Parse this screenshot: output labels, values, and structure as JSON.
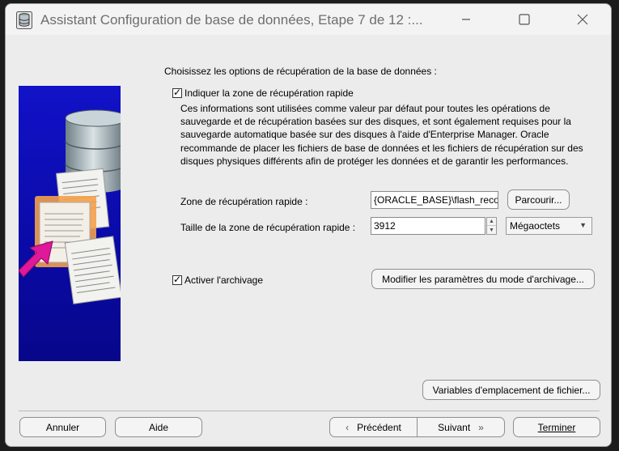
{
  "window": {
    "title": "Assistant Configuration de base de données, Etape 7 de 12 :..."
  },
  "titlebar_buttons": {
    "minimize_icon": "minimize-icon",
    "maximize_icon": "maximize-icon",
    "close_icon": "close-icon"
  },
  "main": {
    "prompt": "Choisissez les options de récupération de la base de données :",
    "fast_recovery": {
      "checked": true,
      "label": "Indiquer la zone de récupération rapide",
      "description": "Ces informations sont utilisées comme valeur par défaut pour toutes les opérations de sauvegarde et de récupération basées sur des disques, et sont également requises pour la sauvegarde automatique basée sur des disques à l'aide d'Enterprise Manager. Oracle recommande de placer les fichiers de base de données et les fichiers de récupération sur des disques physiques différents afin de protéger les données et de garantir les performances.",
      "zone_label": "Zone de récupération rapide :",
      "zone_value": "{ORACLE_BASE}\\flash_reco",
      "browse_label": "Parcourir...",
      "size_label": "Taille de la zone de récupération rapide :",
      "size_value": "3912",
      "unit_value": "Mégaoctets"
    },
    "archiving": {
      "checked": true,
      "label": "Activer l'archivage",
      "modify_label": "Modifier les paramètres du mode d'archivage..."
    },
    "file_vars_label": "Variables d'emplacement de fichier..."
  },
  "footer": {
    "cancel_label": "Annuler",
    "help_label": "Aide",
    "previous_label": "Précédent",
    "next_label": "Suivant",
    "finish_label": "Terminer"
  },
  "colors": {
    "panel_blue": "#0a0aa6",
    "accent_magenta": "#e0189a",
    "accent_orange": "#f2a24a"
  }
}
